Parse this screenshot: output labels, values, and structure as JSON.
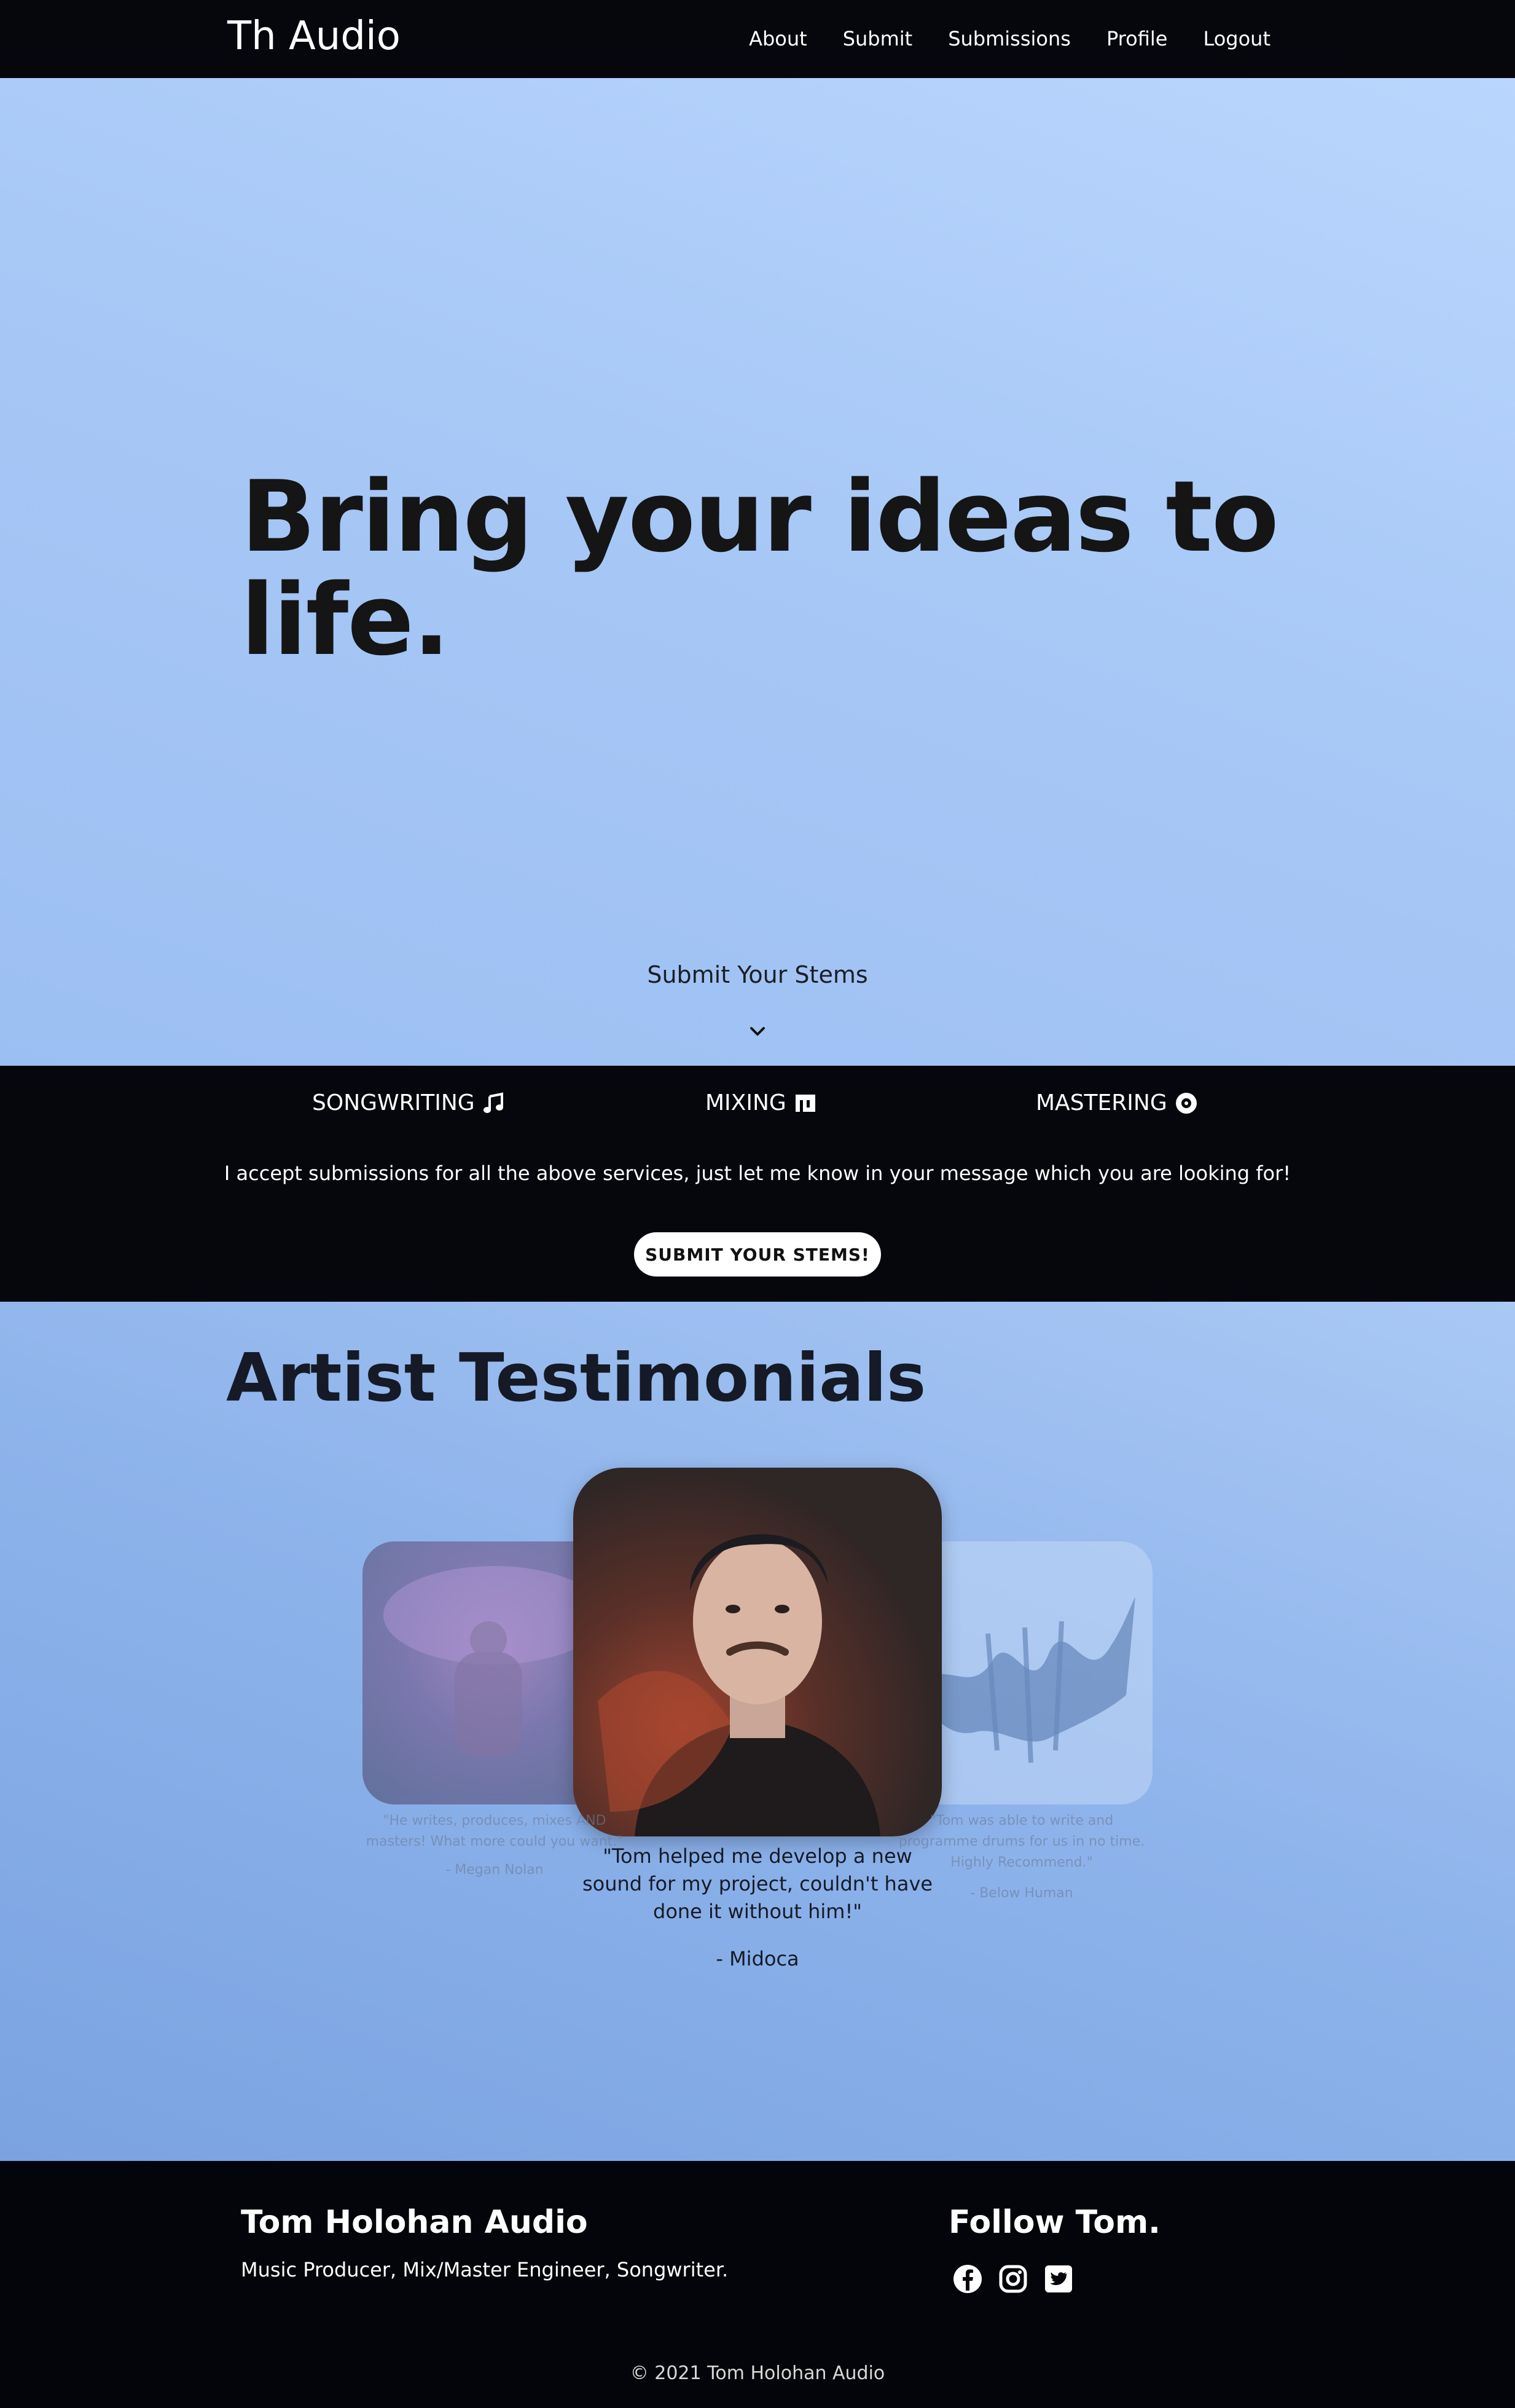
{
  "nav": {
    "brand": "Th Audio",
    "links": [
      "About",
      "Submit",
      "Submissions",
      "Profile",
      "Logout"
    ]
  },
  "hero": {
    "title": "Bring your ideas to life.",
    "cta": "Submit Your Stems"
  },
  "services": {
    "items": [
      "SONGWRITING",
      "MIXING",
      "MASTERING"
    ],
    "note": "I accept submissions for all the above services, just let me know in your message which you are looking for!",
    "button": "SUBMIT YOUR STEMS!"
  },
  "testimonials": {
    "title": "Artist Testimonials",
    "left": {
      "quote": "\"He writes, produces, mixes AND masters! What more could you want.\"",
      "author": "- Megan Nolan"
    },
    "center": {
      "quote": "\"Tom helped me develop a new sound for my project, couldn't have done it without him!\"",
      "author": "- Midoca"
    },
    "right": {
      "quote": "\"Tom was able to write and programme drums for us in no time. Highly Recommend.\"",
      "author": "- Below Human"
    }
  },
  "footer": {
    "title": "Tom Holohan Audio",
    "description": "Music Producer, Mix/Master Engineer, Songwriter.",
    "follow": "Follow Tom.",
    "copyright": "© 2021 Tom Holohan Audio"
  }
}
